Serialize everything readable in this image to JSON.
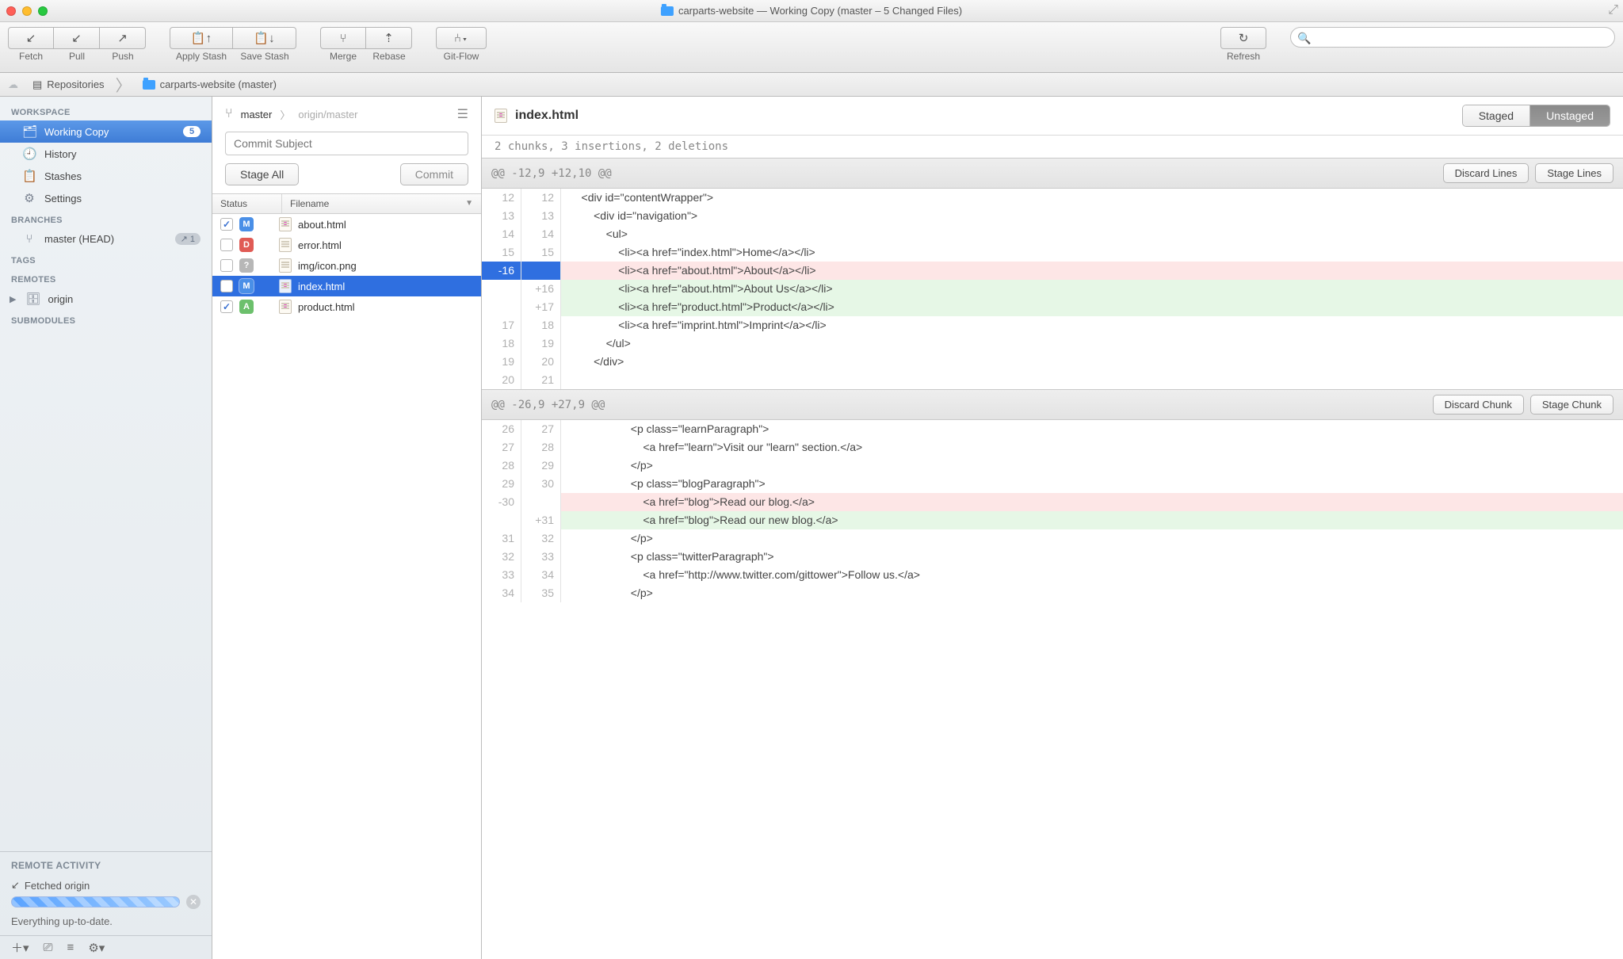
{
  "window": {
    "title": "carparts-website — Working Copy (master – 5 Changed Files)"
  },
  "toolbar": {
    "fetch": "Fetch",
    "pull": "Pull",
    "push": "Push",
    "applyStash": "Apply Stash",
    "saveStash": "Save Stash",
    "merge": "Merge",
    "rebase": "Rebase",
    "gitflow": "Git-Flow",
    "refresh": "Refresh"
  },
  "path": {
    "repos": "Repositories",
    "project": "carparts-website (master)"
  },
  "sidebar": {
    "sec_workspace": "WORKSPACE",
    "workingCopy": "Working Copy",
    "workingCopyBadge": "5",
    "history": "History",
    "stashes": "Stashes",
    "settings": "Settings",
    "sec_branches": "BRANCHES",
    "master": "master (HEAD)",
    "masterBadge": "1",
    "sec_tags": "TAGS",
    "sec_remotes": "REMOTES",
    "origin": "origin",
    "sec_submodules": "SUBMODULES",
    "remoteActivity": "REMOTE ACTIVITY",
    "fetchedOrigin": "Fetched origin",
    "upToDate": "Everything up-to-date."
  },
  "mid": {
    "branch": "master",
    "upstream": "origin/master",
    "commitPlaceholder": "Commit Subject",
    "stageAll": "Stage All",
    "commit": "Commit",
    "hdrStatus": "Status",
    "hdrFilename": "Filename",
    "files": [
      {
        "checked": true,
        "status": "M",
        "name": "about.html",
        "icon": "html"
      },
      {
        "checked": false,
        "status": "D",
        "name": "error.html",
        "icon": "plain"
      },
      {
        "checked": false,
        "status": "?",
        "name": "img/icon.png",
        "icon": "plain"
      },
      {
        "checked": false,
        "status": "M",
        "name": "index.html",
        "icon": "html",
        "selected": true
      },
      {
        "checked": true,
        "status": "A",
        "name": "product.html",
        "icon": "html"
      }
    ]
  },
  "diff": {
    "filename": "index.html",
    "staged": "Staged",
    "unstaged": "Unstaged",
    "summary": "2 chunks, 3 insertions, 2 deletions",
    "hunk1": {
      "range": "@@ -12,9 +12,10 @@",
      "discard": "Discard Lines",
      "stage": "Stage Lines",
      "lines": [
        {
          "o": "12",
          "n": "12",
          "t": "    <div id=\"contentWrapper\">",
          "k": "c"
        },
        {
          "o": "13",
          "n": "13",
          "t": "        <div id=\"navigation\">",
          "k": "c"
        },
        {
          "o": "14",
          "n": "14",
          "t": "            <ul>",
          "k": "c"
        },
        {
          "o": "15",
          "n": "15",
          "t": "                <li><a href=\"index.html\">Home</a></li>",
          "k": "c"
        },
        {
          "o": "-16",
          "n": "",
          "t": "                <li><a href=\"about.html\">About</a></li>",
          "k": "dsel"
        },
        {
          "o": "",
          "n": "+16",
          "t": "                <li><a href=\"about.html\">About Us</a></li>",
          "k": "a"
        },
        {
          "o": "",
          "n": "+17",
          "t": "                <li><a href=\"product.html\">Product</a></li>",
          "k": "a"
        },
        {
          "o": "17",
          "n": "18",
          "t": "                <li><a href=\"imprint.html\">Imprint</a></li>",
          "k": "c"
        },
        {
          "o": "18",
          "n": "19",
          "t": "            </ul>",
          "k": "c"
        },
        {
          "o": "19",
          "n": "20",
          "t": "        </div>",
          "k": "c"
        },
        {
          "o": "20",
          "n": "21",
          "t": "",
          "k": "c"
        }
      ]
    },
    "hunk2": {
      "range": "@@ -26,9 +27,9 @@",
      "discard": "Discard Chunk",
      "stage": "Stage Chunk",
      "lines": [
        {
          "o": "26",
          "n": "27",
          "t": "                    <p class=\"learnParagraph\">",
          "k": "c"
        },
        {
          "o": "27",
          "n": "28",
          "t": "                        <a href=\"learn\">Visit our \"learn\" section.</a>",
          "k": "c"
        },
        {
          "o": "28",
          "n": "29",
          "t": "                    </p>",
          "k": "c"
        },
        {
          "o": "29",
          "n": "30",
          "t": "                    <p class=\"blogParagraph\">",
          "k": "c"
        },
        {
          "o": "-30",
          "n": "",
          "t": "                        <a href=\"blog\">Read our blog.</a>",
          "k": "d"
        },
        {
          "o": "",
          "n": "+31",
          "t": "                        <a href=\"blog\">Read our new blog.</a>",
          "k": "a"
        },
        {
          "o": "31",
          "n": "32",
          "t": "                    </p>",
          "k": "c"
        },
        {
          "o": "32",
          "n": "33",
          "t": "                    <p class=\"twitterParagraph\">",
          "k": "c"
        },
        {
          "o": "33",
          "n": "34",
          "t": "                        <a href=\"http://www.twitter.com/gittower\">Follow us.</a>",
          "k": "c"
        },
        {
          "o": "34",
          "n": "35",
          "t": "                    </p>",
          "k": "c"
        }
      ]
    }
  }
}
